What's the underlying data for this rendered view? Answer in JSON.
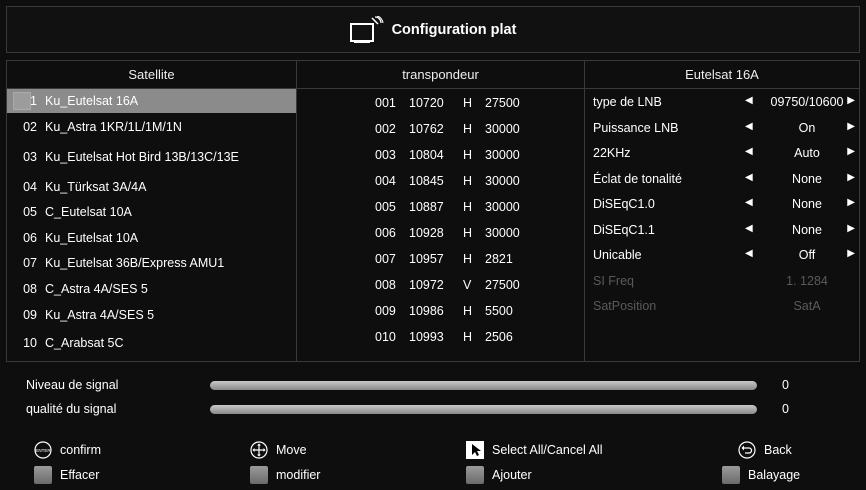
{
  "header": {
    "title": "Configuration plat"
  },
  "satellite": {
    "heading": "Satellite",
    "items": [
      {
        "num": "01",
        "name": "Ku_Eutelsat 16A",
        "selected": true
      },
      {
        "num": "02",
        "name": "Ku_Astra 1KR/1L/1M/1N"
      },
      {
        "num": "03",
        "name": "Ku_Eutelsat Hot Bird 13B/13C/13E"
      },
      {
        "num": "04",
        "name": "Ku_Türksat 3A/4A"
      },
      {
        "num": "05",
        "name": "C_Eutelsat 10A"
      },
      {
        "num": "06",
        "name": "Ku_Eutelsat 10A"
      },
      {
        "num": "07",
        "name": "Ku_Eutelsat 36B/Express AMU1"
      },
      {
        "num": "08",
        "name": "C_Astra 4A/SES 5"
      },
      {
        "num": "09",
        "name": "Ku_Astra 4A/SES 5"
      },
      {
        "num": "10",
        "name": "C_Arabsat 5C"
      }
    ]
  },
  "transponder": {
    "heading": "transpondeur",
    "rows": [
      {
        "idx": "001",
        "freq": "10720",
        "pol": "H",
        "sr": "27500"
      },
      {
        "idx": "002",
        "freq": "10762",
        "pol": "H",
        "sr": "30000"
      },
      {
        "idx": "003",
        "freq": "10804",
        "pol": "H",
        "sr": "30000"
      },
      {
        "idx": "004",
        "freq": "10845",
        "pol": "H",
        "sr": "30000"
      },
      {
        "idx": "005",
        "freq": "10887",
        "pol": "H",
        "sr": "30000"
      },
      {
        "idx": "006",
        "freq": "10928",
        "pol": "H",
        "sr": "30000"
      },
      {
        "idx": "007",
        "freq": "10957",
        "pol": "H",
        "sr": "2821"
      },
      {
        "idx": "008",
        "freq": "10972",
        "pol": "V",
        "sr": "27500"
      },
      {
        "idx": "009",
        "freq": "10986",
        "pol": "H",
        "sr": "5500"
      },
      {
        "idx": "010",
        "freq": "10993",
        "pol": "H",
        "sr": "2506"
      }
    ]
  },
  "config": {
    "heading": "Eutelsat 16A",
    "rows": [
      {
        "label": "type de LNB",
        "value": "09750/10600",
        "arrows": true
      },
      {
        "label": "Puissance LNB",
        "value": "On",
        "arrows": true
      },
      {
        "label": "22KHz",
        "value": "Auto",
        "arrows": true
      },
      {
        "label": "Éclat de tonalité",
        "value": "None",
        "arrows": true
      },
      {
        "label": "DiSEqC1.0",
        "value": "None",
        "arrows": true
      },
      {
        "label": "DiSEqC1.1",
        "value": "None",
        "arrows": true
      },
      {
        "label": "Unicable",
        "value": "Off",
        "arrows": true
      },
      {
        "label": "SI Freq",
        "value": "1. 1284",
        "arrows": false,
        "disabled": true
      },
      {
        "label": "SatPosition",
        "value": "SatA",
        "arrows": false,
        "disabled": true
      }
    ]
  },
  "signal": {
    "level_label": "Niveau de signal",
    "level_value": "0",
    "level_fraction": 0,
    "quality_label": "qualité du signal",
    "quality_value": "0",
    "quality_fraction": 0
  },
  "legend": {
    "confirm": "confirm",
    "enter_key": "ENTER",
    "move": "Move",
    "select_all": "Select All/Cancel All",
    "back": "Back",
    "effacer": "Effacer",
    "modifier": "modifier",
    "ajouter": "Ajouter",
    "balayage": "Balayage"
  },
  "icons": {
    "header": "tv-dish-icon",
    "confirm": "enter-button-icon",
    "move": "dpad-move-icon",
    "select_all": "cursor-select-icon",
    "back": "back-arrow-icon",
    "color_keys": "grey-key-icon"
  },
  "colors": {
    "background": "#0e0e0e",
    "selected_row": "#8b8b8b",
    "border": "#3a3a3a",
    "disabled_text": "#5a5a5a"
  }
}
